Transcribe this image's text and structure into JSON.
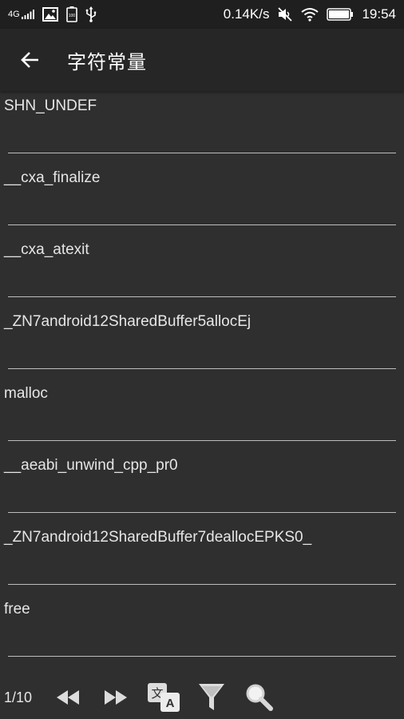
{
  "status_bar": {
    "network": "4G",
    "speed": "0.14K/s",
    "time": "19:54",
    "battery_badge": "100"
  },
  "header": {
    "title": "字符常量"
  },
  "items": [
    {
      "label": "SHN_UNDEF"
    },
    {
      "label": "__cxa_finalize"
    },
    {
      "label": "__cxa_atexit"
    },
    {
      "label": "_ZN7android12SharedBuffer5allocEj"
    },
    {
      "label": "malloc"
    },
    {
      "label": "__aeabi_unwind_cpp_pr0"
    },
    {
      "label": "_ZN7android12SharedBuffer7deallocEPKS0_"
    },
    {
      "label": "free"
    }
  ],
  "bottom_bar": {
    "page": "1/10",
    "icons": [
      "rewind-icon",
      "fast-forward-icon",
      "translate-icon",
      "filter-icon",
      "search-icon"
    ]
  },
  "colors": {
    "background": "#2f2f2f",
    "app_bar": "#262626",
    "status_bar": "#1f1f1f",
    "text": "#e6e6e6",
    "underline": "#bdbdbd"
  }
}
